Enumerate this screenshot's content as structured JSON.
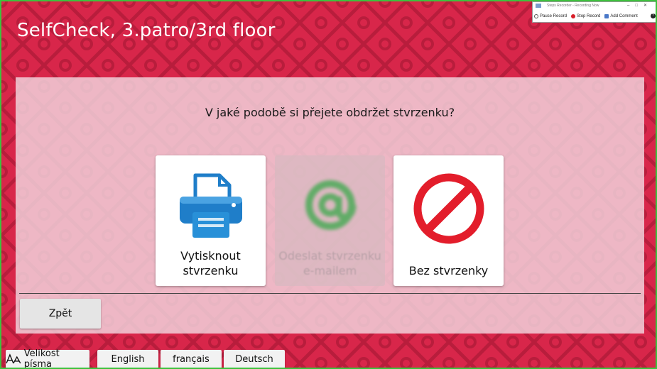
{
  "app": {
    "title": "SelfCheck, 3.patro/3rd floor"
  },
  "recorder": {
    "title": "Steps Recorder - Recording Now",
    "pause_label": "Pause Record",
    "stop_label": "Stop Record",
    "comment_label": "Add Comment",
    "help_label": "?"
  },
  "main": {
    "question": "V jaké podobě si přejete obdržet stvrzenku?",
    "options": [
      {
        "line1": "Vytisknout",
        "line2": "stvrzenku",
        "icon": "printer-icon",
        "enabled": true
      },
      {
        "line1": "Odeslat stvrzenku",
        "line2": "e-mailem",
        "icon": "at-sign-icon",
        "enabled": false
      },
      {
        "line1": "Bez stvrzenky",
        "line2": "",
        "icon": "no-entry-icon",
        "enabled": true
      }
    ],
    "back_label": "Zpět"
  },
  "footer": {
    "font_size_label": "Velikost písma",
    "languages": [
      "English",
      "français",
      "Deutsch"
    ]
  },
  "colors": {
    "background": "#d8264a",
    "printer_blue": "#1f7ec9",
    "email_green": "#39a84a",
    "stop_red": "#e31d2b",
    "window_border": "#3cc23c"
  }
}
